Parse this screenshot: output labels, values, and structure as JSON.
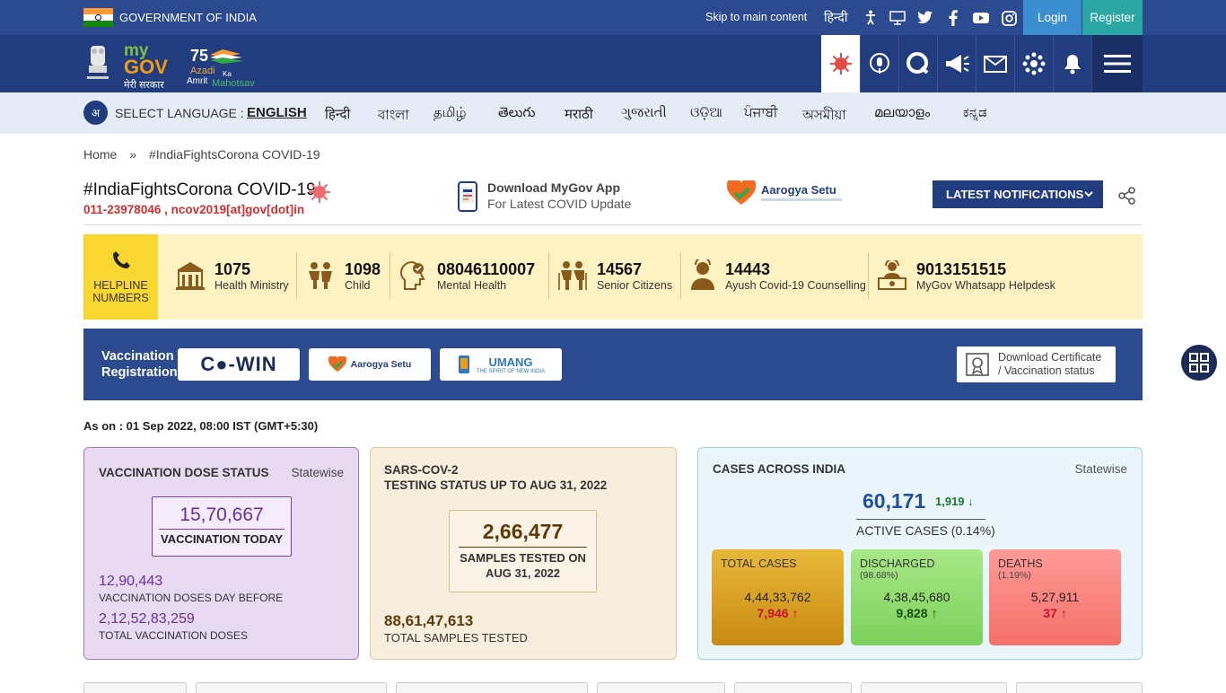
{
  "govbar": {
    "text": "GOVERNMENT OF INDIA",
    "skip": "Skip to main content",
    "hindi": "हिन्दी",
    "login": "Login",
    "register": "Register"
  },
  "header": {
    "mygov_my": "my",
    "mygov_gov": "GOV",
    "mygov_sarkar": "मेरी सरकार"
  },
  "language": {
    "label": "SELECT LANGUAGE :",
    "items": [
      "ENGLISH",
      "हिन्दी",
      "বাংলা",
      "தமிழ்",
      "తెలుగు",
      "मराठी",
      "ગુજરાતી",
      "ଓଡ଼ିଆ",
      "ਪੰਜਾਬੀ",
      "অসমীয়া",
      "മലയാളം",
      "ಕನ್ನಡ"
    ]
  },
  "breadcrumb": {
    "home": "Home",
    "sep": "»",
    "current": "#IndiaFightsCorona COVID-19"
  },
  "page": {
    "title": "#IndiaFightsCorona COVID-19",
    "contact": "011-23978046 , ncov2019[at]gov[dot]in",
    "app_t1": "Download MyGov App",
    "app_t2": "For Latest COVID Update",
    "aarogya": "Aarogya Setu",
    "latest": "LATEST NOTIFICATIONS"
  },
  "helpline": {
    "label1": "HELPLINE",
    "label2": "NUMBERS",
    "items": [
      {
        "num": "1075",
        "label": "Health Ministry"
      },
      {
        "num": "1098",
        "label": "Child"
      },
      {
        "num": "08046110007",
        "label": "Mental Health"
      },
      {
        "num": "14567",
        "label": "Senior Citizens"
      },
      {
        "num": "14443",
        "label": "Ayush Covid-19 Counselling"
      },
      {
        "num": "9013151515",
        "label": "MyGov Whatsapp Helpdesk"
      }
    ]
  },
  "vaccination_reg": {
    "label1": "Vaccination",
    "label2": "Registration",
    "cowin": "C●-WIN",
    "aarogya": "Aarogya Setu",
    "umang": "UMANG",
    "umang_sub": "THE SPIRIT OF NEW INDIA",
    "cert1": "Download Certificate",
    "cert2": "/ Vaccination status"
  },
  "as_on": "As on : 01 Sep 2022, 08:00 IST (GMT+5:30)",
  "vaccination": {
    "heading": "VACCINATION DOSE STATUS",
    "statewise": "Statewise",
    "today_num": "15,70,667",
    "today_label": "VACCINATION TODAY",
    "before_num": "12,90,443",
    "before_label": "VACCINATION DOSES DAY BEFORE",
    "total_num": "2,12,52,83,259",
    "total_label": "TOTAL VACCINATION DOSES"
  },
  "testing": {
    "heading1": "SARS-COV-2",
    "heading2": "TESTING STATUS UP TO AUG 31, 2022",
    "samples_num": "2,66,477",
    "samples_l1": "SAMPLES TESTED ON",
    "samples_l2": "AUG 31, 2022",
    "total_num": "88,61,47,613",
    "total_label": "TOTAL SAMPLES TESTED"
  },
  "cases": {
    "heading": "CASES ACROSS INDIA",
    "statewise": "Statewise",
    "active_num": "60,171",
    "active_delta": "1,919 ↓",
    "active_label": "ACTIVE CASES (0.14%)",
    "total": {
      "label": "TOTAL CASES",
      "pct": "",
      "value": "4,44,33,762",
      "delta": "7,946 ↑",
      "color": "#e0a92a"
    },
    "discharged": {
      "label": "DISCHARGED",
      "pct": "(98.68%)",
      "value": "4,38,45,680",
      "delta": "9,828 ↑",
      "color": "#9ee07f"
    },
    "deaths": {
      "label": "DEATHS",
      "pct": "(1.19%)",
      "value": "5,27,911",
      "delta": "37 ↑",
      "color": "#ff8a86"
    }
  },
  "colors": {
    "primary": "#213c7f",
    "gov_bar": "#2b4a8f",
    "login": "#3b8fd0",
    "register": "#2aa7a5",
    "helpline_bg": "#fff2c2",
    "helpline_box": "#f9d630"
  }
}
